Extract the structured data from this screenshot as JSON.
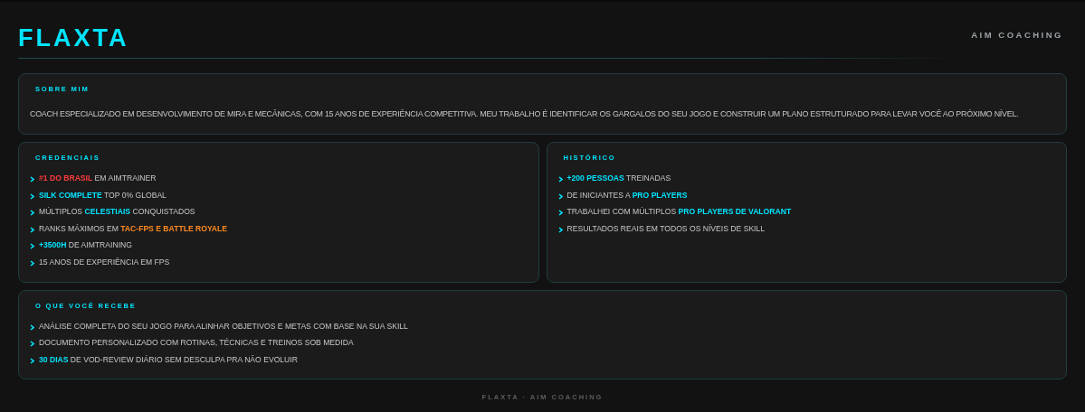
{
  "header": {
    "logo": "FLAXTA",
    "tagline": "AIM COACHING"
  },
  "about": {
    "title": "SOBRE MIM",
    "text": "COACH ESPECIALIZADO EM DESENVOLVIMENTO DE MIRA E MECÂNICAS, COM 15 ANOS DE EXPERIÊNCIA COMPETITIVA. MEU TRABALHO É IDENTIFICAR OS GARGALOS DO SEU JOGO E CONSTRUIR UM PLANO ESTRUTURADO PARA LEVAR VOCÊ AO PRÓXIMO NÍVEL."
  },
  "sections": [
    {
      "title": "CREDENCIAIS",
      "items": [
        [
          {
            "text": "#1 DO BRASIL",
            "color": "#ff3b3b"
          },
          {
            "text": " EM AIMTRAINER"
          }
        ],
        [
          {
            "text": "SILK COMPLETE",
            "color": "#00e5ff"
          },
          {
            "text": " TOP 0% GLOBAL"
          }
        ],
        [
          {
            "text": "MÚLTIPLOS "
          },
          {
            "text": "CELESTIAIS",
            "color": "#00e5ff"
          },
          {
            "text": " CONQUISTADOS"
          }
        ],
        [
          {
            "text": "RANKS MÁXIMOS EM "
          },
          {
            "text": "TAC-FPS E BATTLE ROYALE",
            "color": "#ff8a1f"
          }
        ],
        [
          {
            "text": "+3500H",
            "color": "#00e5ff"
          },
          {
            "text": " DE AIMTRAINING"
          }
        ],
        [
          {
            "text": "15 ANOS DE EXPERIÊNCIA EM FPS"
          }
        ]
      ]
    },
    {
      "title": "HISTÓRICO",
      "items": [
        [
          {
            "text": "+200 PESSOAS",
            "color": "#00e5ff"
          },
          {
            "text": " TREINADAS"
          }
        ],
        [
          {
            "text": "DE INICIANTES A "
          },
          {
            "text": "PRO PLAYERS",
            "color": "#00e5ff"
          }
        ],
        [
          {
            "text": "TRABALHEI COM MÚLTIPLOS "
          },
          {
            "text": "PRO PLAYERS DE VALORANT",
            "color": "#00e5ff"
          }
        ],
        [
          {
            "text": "RESULTADOS REAIS EM TODOS OS NÍVEIS DE SKILL"
          }
        ]
      ]
    },
    {
      "title": "O QUE VOCÊ RECEBE",
      "items": [
        [
          {
            "text": "ANÁLISE COMPLETA DO SEU JOGO PARA ALINHAR OBJETIVOS E METAS COM BASE NA SUA SKILL"
          }
        ],
        [
          {
            "text": "DOCUMENTO PERSONALIZADO COM ROTINAS, TÉCNICAS E TREINOS SOB MEDIDA"
          }
        ],
        [
          {
            "text": "30 DIAS",
            "color": "#00e5ff"
          },
          {
            "text": " DE VOD-REVIEW DIÁRIO SEM DESCULPA PRA NÃO EVOLUIR"
          }
        ]
      ]
    }
  ],
  "footer": "FLAXTA · AIM COACHING"
}
